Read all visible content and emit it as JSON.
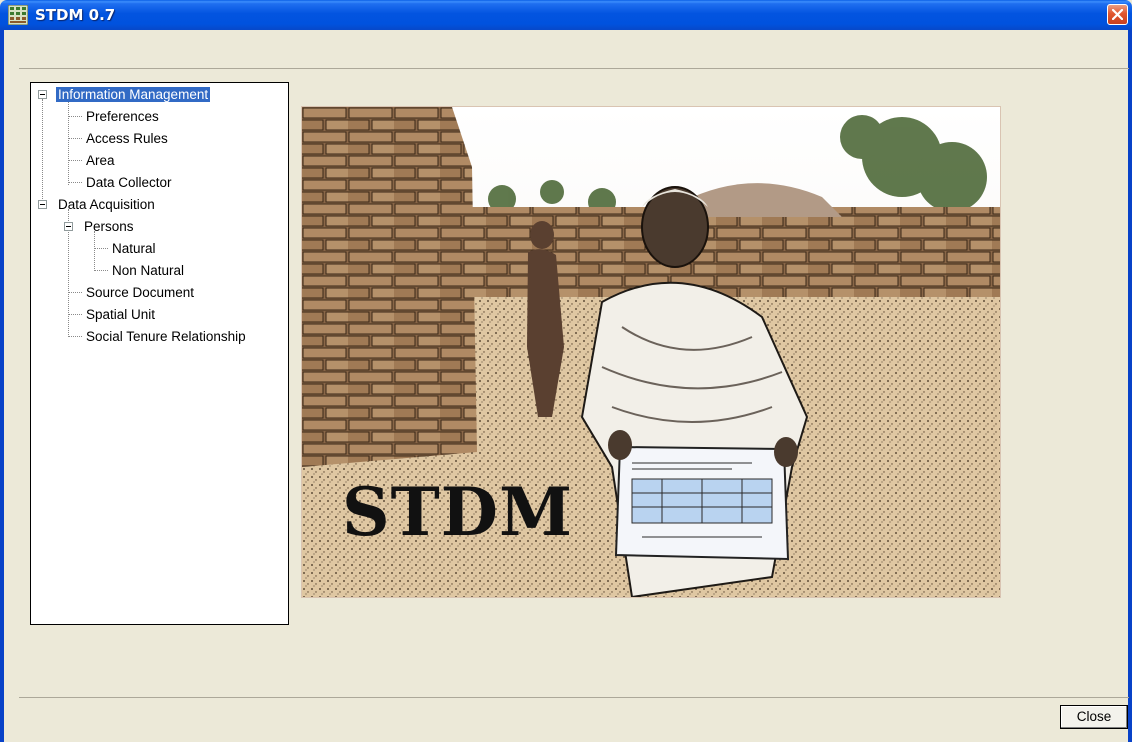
{
  "window": {
    "title": "STDM 0.7",
    "icon": "app-grid-icon",
    "close_icon": "close-icon"
  },
  "tree": {
    "nodes": [
      {
        "label": "Information Management",
        "selected": true
      },
      {
        "label": "Preferences"
      },
      {
        "label": "Access Rules"
      },
      {
        "label": "Area"
      },
      {
        "label": "Data Collector"
      },
      {
        "label": "Data Acquisition"
      },
      {
        "label": "Persons"
      },
      {
        "label": "Natural"
      },
      {
        "label": "Non Natural"
      },
      {
        "label": "Source Document"
      },
      {
        "label": "Spatial Unit"
      },
      {
        "label": "Social Tenure Relationship"
      }
    ]
  },
  "splash": {
    "logo_text": "STDM"
  },
  "footer": {
    "close_label": "Close"
  },
  "colors": {
    "titlebar": "#0054e3",
    "selection": "#316ac5",
    "dialog_bg": "#ece9d8"
  }
}
